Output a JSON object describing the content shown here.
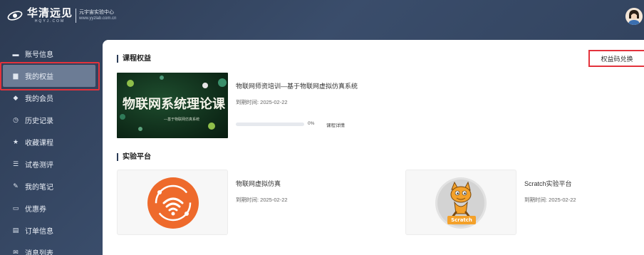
{
  "header": {
    "logo_main": "华清远见",
    "logo_en": "HQYJ.COM",
    "logo_right_title": "元宇宙实验中心",
    "logo_right_url": "www.yyzlab.com.cn"
  },
  "sidebar": {
    "items": [
      {
        "label": "账号信息",
        "icon": "id-card-icon",
        "glyph": "▬"
      },
      {
        "label": "我的权益",
        "icon": "benefits-icon",
        "glyph": "▆"
      },
      {
        "label": "我的会员",
        "icon": "diamond-icon",
        "glyph": "◆"
      },
      {
        "label": "历史记录",
        "icon": "clock-icon",
        "glyph": "◷"
      },
      {
        "label": "收藏课程",
        "icon": "star-icon",
        "glyph": "★"
      },
      {
        "label": "试卷测评",
        "icon": "exam-icon",
        "glyph": "☰"
      },
      {
        "label": "我的笔记",
        "icon": "note-icon",
        "glyph": "✎"
      },
      {
        "label": "优惠券",
        "icon": "coupon-icon",
        "glyph": "▭"
      },
      {
        "label": "订单信息",
        "icon": "order-icon",
        "glyph": "▤"
      },
      {
        "label": "消息列表",
        "icon": "message-icon",
        "glyph": "✉"
      }
    ],
    "active_index": 1
  },
  "main": {
    "benefits_title": "课程权益",
    "redeem_label": "权益码兑换",
    "course": {
      "thumb_title": "物联网系统理论课",
      "thumb_subtitle": "—基于物联网仿真系统",
      "title": "物联网师资培训—基于物联网虚拟仿真系统",
      "expire": "到期时间: 2025-02-22",
      "progress": 0,
      "progress_label": "0%",
      "detail_label": "课程详情"
    },
    "platform_title": "实验平台",
    "platforms": [
      {
        "name": "物联网虚拟仿真",
        "expire": "到期时间: 2025-02-22",
        "icon": "iot-wifi-icon"
      },
      {
        "name": "Scratch实验平台",
        "expire": "到期时间: 2025-02-22",
        "icon": "scratch-cat-icon",
        "badge": "Scratch"
      }
    ]
  },
  "colors": {
    "accent_red": "#e3333c",
    "iot_orange": "#ee6a2c",
    "sidebar_bg": "#2c3a52"
  }
}
